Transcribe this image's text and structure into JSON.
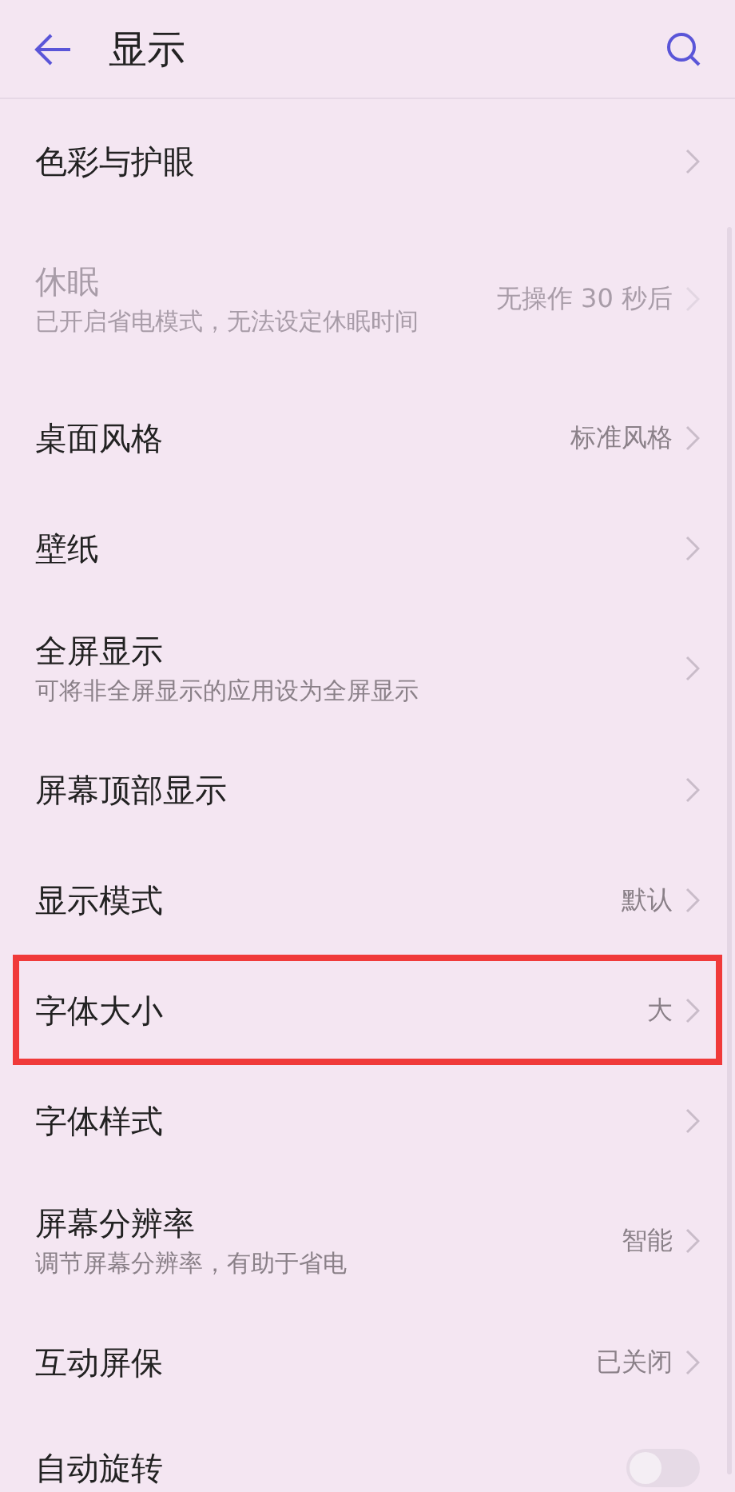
{
  "header": {
    "title": "显示"
  },
  "rows": [
    {
      "kind": "link",
      "title": "色彩与护眼",
      "disabled": false,
      "highlighted": false
    },
    {
      "kind": "link",
      "title": "休眠",
      "subtitle": "已开启省电模式，无法设定休眠时间",
      "value": "无操作 30 秒后",
      "disabled": true,
      "highlighted": false
    },
    {
      "kind": "link",
      "title": "桌面风格",
      "value": "标准风格",
      "disabled": false,
      "highlighted": false
    },
    {
      "kind": "link",
      "title": "壁纸",
      "disabled": false,
      "highlighted": false
    },
    {
      "kind": "link",
      "title": "全屏显示",
      "subtitle": "可将非全屏显示的应用设为全屏显示",
      "disabled": false,
      "highlighted": false
    },
    {
      "kind": "link",
      "title": "屏幕顶部显示",
      "disabled": false,
      "highlighted": false
    },
    {
      "kind": "link",
      "title": "显示模式",
      "value": "默认",
      "disabled": false,
      "highlighted": false
    },
    {
      "kind": "link",
      "title": "字体大小",
      "value": "大",
      "disabled": false,
      "highlighted": true
    },
    {
      "kind": "link",
      "title": "字体样式",
      "disabled": false,
      "highlighted": false
    },
    {
      "kind": "link",
      "title": "屏幕分辨率",
      "subtitle": "调节屏幕分辨率，有助于省电",
      "value": "智能",
      "disabled": false,
      "highlighted": false
    },
    {
      "kind": "link",
      "title": "互动屏保",
      "value": "已关闭",
      "disabled": false,
      "highlighted": false
    },
    {
      "kind": "toggle",
      "title": "自动旋转",
      "on": false,
      "disabled": false,
      "highlighted": false
    }
  ]
}
